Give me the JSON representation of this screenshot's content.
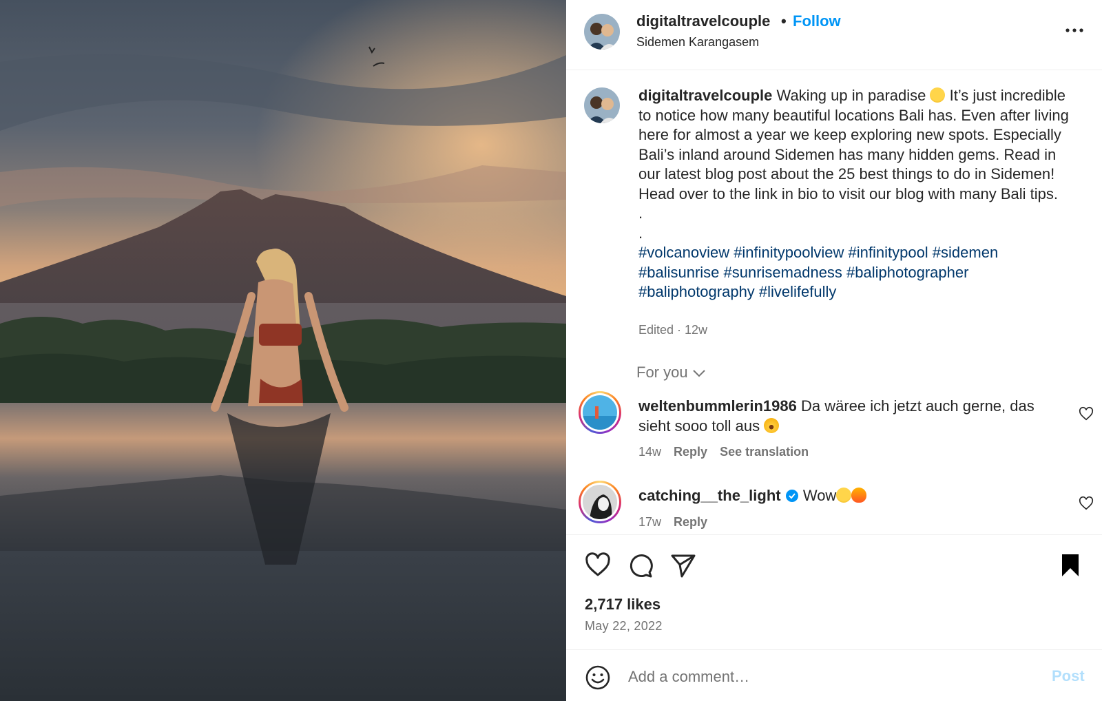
{
  "post": {
    "username": "digitaltravelcouple",
    "follow_label": "Follow",
    "separator": "•",
    "location": "Sidemen Karangasem"
  },
  "caption": {
    "username": "digitaltravelcouple",
    "text_1": " Waking up in paradise ",
    "text_2": " It’s just incredible to notice how many beautiful locations Bali has. Even after living here for almost a year we keep exploring new spots. Especially Bali’s inland around Sidemen has many hidden gems. Read in our latest blog post about the 25 best things to do in Sidemen! Head over to the link in bio to visit our blog with many Bali tips.",
    "dot_1": ".",
    "dot_2": ".",
    "hashtags": "#volcanoview #infinitypoolview #infinitypool #sidemen #balisunrise #sunrisemadness #baliphotographer #baliphotography #livelifefully",
    "edited": "Edited · 12w"
  },
  "for_you": "For you",
  "comments": [
    {
      "username": "weltenbummlerin1986",
      "text": " Da wäree ich jetzt auch gerne, das sieht sooo toll aus ",
      "time": "14w",
      "reply": "Reply",
      "translate": "See translation"
    },
    {
      "username": "catching__the_light",
      "text": " Wow",
      "time": "17w",
      "reply": "Reply"
    }
  ],
  "likes": "2,717 likes",
  "date": "May 22, 2022",
  "add_comment": {
    "placeholder": "Add a comment…",
    "post_label": "Post"
  },
  "colors": {
    "accent": "#0095f6",
    "hashtag": "#00376b",
    "muted": "#737373",
    "post_disabled": "#b2dffc"
  },
  "icons": [
    "more-icon",
    "chevron-down-icon",
    "heart-icon",
    "comment-icon",
    "share-icon",
    "bookmark-icon",
    "emoji-icon",
    "verified-icon"
  ]
}
